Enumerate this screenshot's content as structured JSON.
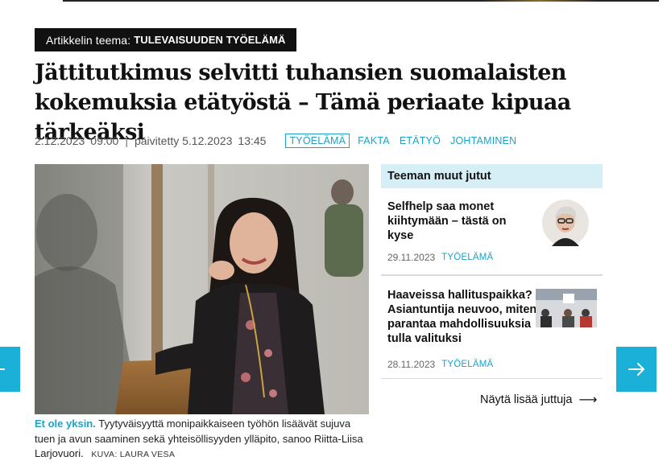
{
  "theme": {
    "key": "Artikkelin teema:",
    "value": "TULEVAISUUDEN TYÖELÄMÄ"
  },
  "headline": "Jättitutkimus selvitti tuhansien suomalaisten kokemuksia etätyöstä – Tämä periaate kipuaa tärkeäksi",
  "meta": {
    "date": "2.12.2023",
    "time": "09:00",
    "separator": "|",
    "updated_label": "päivitetty 5.12.2023",
    "updated_time": "13:45"
  },
  "tags": [
    "TYÖELÄMÄ",
    "FAKTA",
    "ETÄTYÖ",
    "JOHTAMINEN"
  ],
  "photo": {
    "caption_lead": "Et ole yksin.",
    "caption_text": "Tyytyväisyyttä monipaikkaiseen työhön lisäävät sujuva tuen ja avun saaminen sekä yhteisöllisyyden ylläpito, sanoo Riitta-Liisa Larjovuori.",
    "credit": "KUVA: LAURA VESA"
  },
  "sidebar": {
    "heading": "Teeman muut jutut",
    "stories": [
      {
        "title": "Selfhelp saa monet kiihtymään – tästä on kyse",
        "date": "29.11.2023",
        "tag": "TYÖELÄMÄ"
      },
      {
        "title": "Haaveissa hallituspaikka? Asiantuntija neuvoo, miten parantaa mahdollisuuksia tulla valituksi",
        "date": "28.11.2023",
        "tag": "TYÖELÄMÄ"
      }
    ],
    "more_label": "Näytä lisää juttuja",
    "more_arrow": "⟶"
  },
  "nav": {
    "prev_icon": "arrow-left-icon",
    "next_icon": "arrow-right-icon"
  },
  "colors": {
    "accent": "#1aa3c7",
    "nav_bg": "#1ab0d8",
    "sidebar_head_bg": "#d6eef5"
  }
}
